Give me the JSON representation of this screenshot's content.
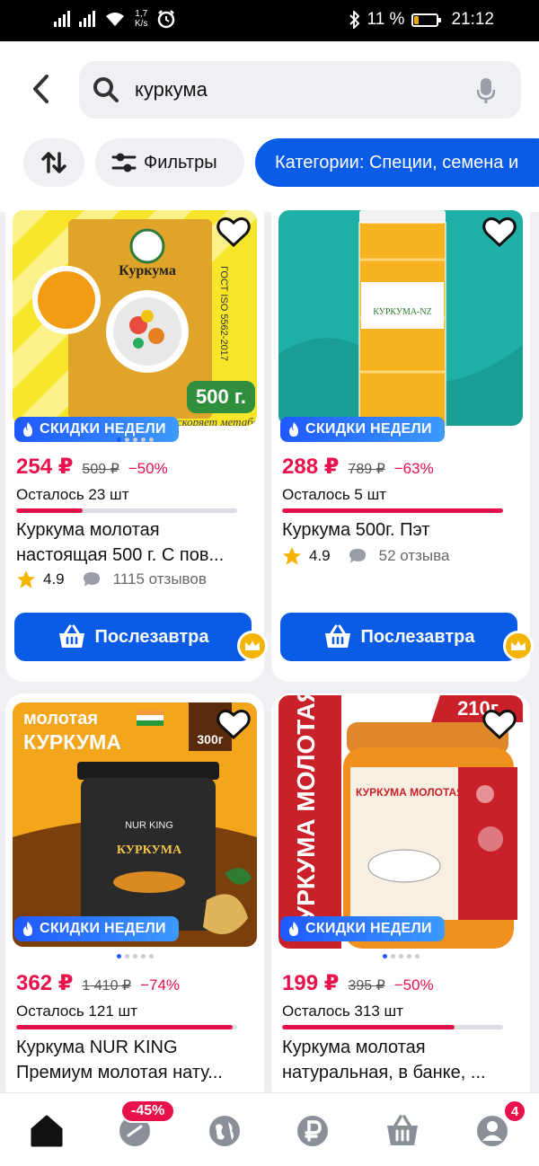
{
  "status_bar": {
    "speed_value": "1,7",
    "speed_unit": "K/s",
    "battery_percent": "11 %",
    "time": "21:12"
  },
  "search": {
    "query": "куркума"
  },
  "filters": {
    "filters_label": "Фильтры",
    "category_label": "Категории: Специи, семена и"
  },
  "products": [
    {
      "price": "254 ₽",
      "old_price": "509 ₽",
      "discount": "−50%",
      "stock_text": "Осталось 23 шт",
      "stock_fraction": 0.3,
      "title": "Куркума молотая настоящая 500 г. С пов...",
      "rating": "4.9",
      "reviews": "1115 отзывов",
      "badge": "СКИДКИ НЕДЕЛИ",
      "delivery": "Послезавтра",
      "photo_text": {
        "brand": "Куркума",
        "weight": "500 г.",
        "std": "ГОСТ ISO 5562-2017",
        "caption": "ускоряет метаболизм"
      }
    },
    {
      "price": "288 ₽",
      "old_price": "789 ₽",
      "discount": "−63%",
      "stock_text": "Осталось 5 шт",
      "stock_fraction": 1.0,
      "title": "Куркума 500г. Пэт",
      "rating": "4.9",
      "reviews": "52 отзыва",
      "badge": "СКИДКИ НЕДЕЛИ",
      "delivery": "Послезавтра",
      "photo_text": {
        "label": "КУРКУМА-NZ"
      }
    },
    {
      "price": "362 ₽",
      "old_price": "1 410 ₽",
      "discount": "−74%",
      "stock_text": "Осталось 121 шт",
      "stock_fraction": 0.98,
      "title": "Куркума NUR KING Премиум молотая нату...",
      "badge": "СКИДКИ НЕДЕЛИ",
      "photo_text": {
        "line1": "молотая",
        "line2": "КУРКУМА",
        "weight": "300г",
        "brand": "NUR KING",
        "name": "КУРКУМА"
      }
    },
    {
      "price": "199 ₽",
      "old_price": "395 ₽",
      "discount": "−50%",
      "stock_text": "Осталось 313 шт",
      "stock_fraction": 0.78,
      "title": "Куркума молотая натуральная, в банке, ...",
      "badge": "СКИДКИ НЕДЕЛИ",
      "photo_text": {
        "side": "КУРКУМА МОЛОТАЯ",
        "weight": "210г",
        "label": "КУРКУМА МОЛОТАЯ"
      }
    }
  ],
  "bottom_nav": {
    "promo_badge": "-45%",
    "cart_count": "4"
  },
  "colors": {
    "accent": "#0a5ce6",
    "price": "#e8114b",
    "badge": "#1f58ff",
    "crown": "#f5b400"
  }
}
